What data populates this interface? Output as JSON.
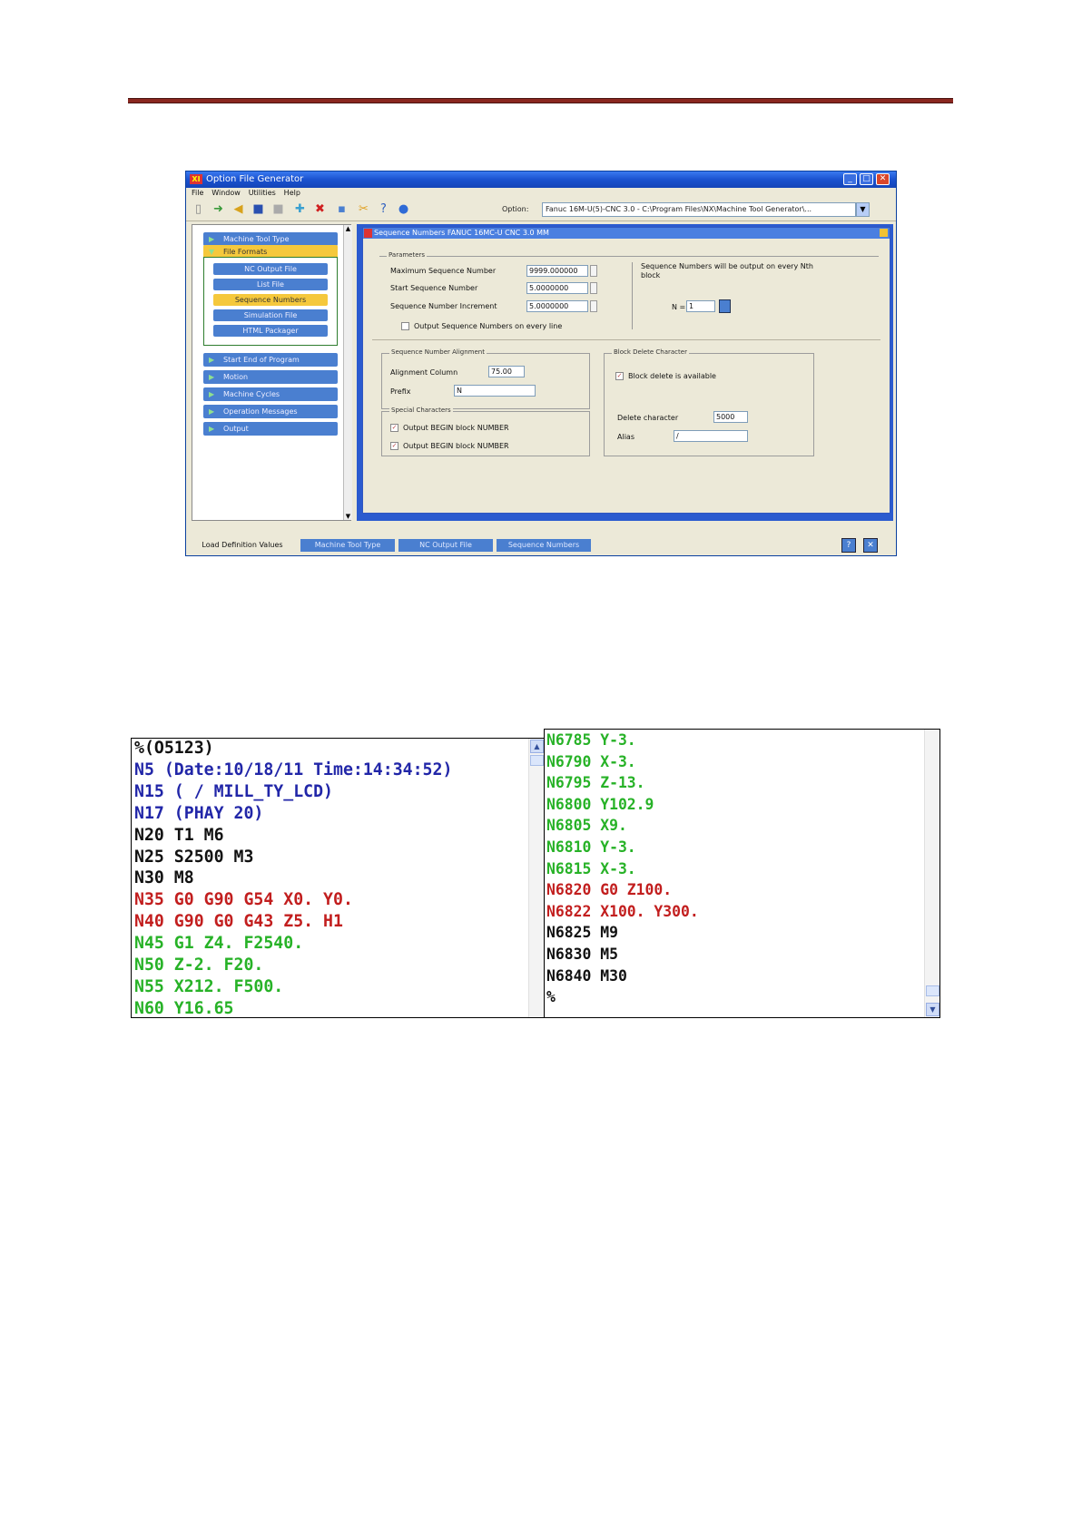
{
  "window": {
    "title": "Option File Generator",
    "menu": [
      "File",
      "Window",
      "Utilities",
      "Help"
    ],
    "toolbar_label": "Option:",
    "toolbar_path": "Fanuc 16M-U(5)-CNC 3.0 - C:\\Program Files\\NX\\Machine Tool Generator\\..."
  },
  "nav": {
    "machine_tool_type": "Machine Tool Type",
    "file_formats": "File Formats",
    "sub_items": [
      "NC Output File",
      "List File",
      "Sequence Numbers",
      "Simulation File",
      "HTML Packager"
    ],
    "other_items": [
      "Start End of Program",
      "Motion",
      "Machine Cycles",
      "Operation Messages",
      "Output"
    ]
  },
  "dialog": {
    "title": "Sequence Numbers    FANUC 16MC-U    CNC 3.0 MM",
    "group_main": "Parameters",
    "max_label": "Maximum Sequence Number",
    "max_value": "9999.000000",
    "start_label": "Start Sequence Number",
    "start_value": "5.0000000",
    "inc_label": "Sequence Number Increment",
    "inc_value": "5.0000000",
    "note": "Sequence Numbers will be output on every Nth block",
    "n_label": "N =",
    "n_value": "1",
    "checkbox_output": "Output Sequence Numbers on every line",
    "alignment_group": "Sequence Number Alignment",
    "alignment_label": "Alignment Column",
    "alignment_value": "75.00",
    "prefix_label": "Prefix",
    "prefix_value": "N",
    "special_group": "Special Characters",
    "special_cb1": "Output BEGIN block NUMBER",
    "special_cb2": "Output BEGIN block NUMBER",
    "delete_group": "Block Delete Character",
    "delete_cb": "Block delete is available",
    "delete_char_label": "Delete character",
    "delete_char_value": "5000",
    "alias_label": "Alias",
    "alias_value": "/"
  },
  "tabs": [
    "Load Definition Values",
    "Machine Tool Type",
    "NC Output File",
    "Sequence Numbers"
  ],
  "code_left": [
    {
      "text": "%(O5123)",
      "color": "black"
    },
    {
      "text": "N5 (Date:10/18/11 Time:14:34:52)",
      "color": "blue"
    },
    {
      "text": "N15 ( / MILL_TY_LCD)",
      "color": "blue"
    },
    {
      "text": "N17 (PHAY 20)",
      "color": "blue"
    },
    {
      "text": "N20 T1 M6",
      "color": "black"
    },
    {
      "text": "N25 S2500 M3",
      "color": "black"
    },
    {
      "text": "N30 M8",
      "color": "black"
    },
    {
      "text": "N35 G0 G90 G54 X0. Y0.",
      "color": "red"
    },
    {
      "text": "N40 G90 G0 G43 Z5. H1",
      "color": "red"
    },
    {
      "text": "N45 G1 Z4. F2540.",
      "color": "green"
    },
    {
      "text": "N50 Z-2. F20.",
      "color": "green"
    },
    {
      "text": "N55 X212. F500.",
      "color": "green"
    },
    {
      "text": "N60 Y16.65",
      "color": "green"
    }
  ],
  "code_right": [
    {
      "text": "N6785 Y-3.",
      "color": "green"
    },
    {
      "text": "N6790 X-3.",
      "color": "green"
    },
    {
      "text": "N6795 Z-13.",
      "color": "green"
    },
    {
      "text": "N6800 Y102.9",
      "color": "green"
    },
    {
      "text": "N6805 X9.",
      "color": "green"
    },
    {
      "text": "N6810 Y-3.",
      "color": "green"
    },
    {
      "text": "N6815 X-3.",
      "color": "green"
    },
    {
      "text": "N6820 G0 Z100.",
      "color": "red"
    },
    {
      "text": "N6822 X100. Y300.",
      "color": "red"
    },
    {
      "text": "N6825 M9",
      "color": "black"
    },
    {
      "text": "N6830 M5",
      "color": "black"
    },
    {
      "text": "N6840 M30",
      "color": "black"
    },
    {
      "text": "%",
      "color": "black"
    }
  ],
  "colors": {
    "header_rule": "#8a2720",
    "code_blue": "#2126a8",
    "code_red": "#c21e1e",
    "code_green": "#27b227",
    "nav_blue": "#4a7fd0",
    "nav_active": "#f5c83c"
  },
  "icons": [
    "new-file-icon",
    "open-icon",
    "undo-icon",
    "save-icon",
    "print-icon",
    "add-icon",
    "delete-icon",
    "copy-icon",
    "tools-icon",
    "help-icon",
    "globe-icon"
  ]
}
